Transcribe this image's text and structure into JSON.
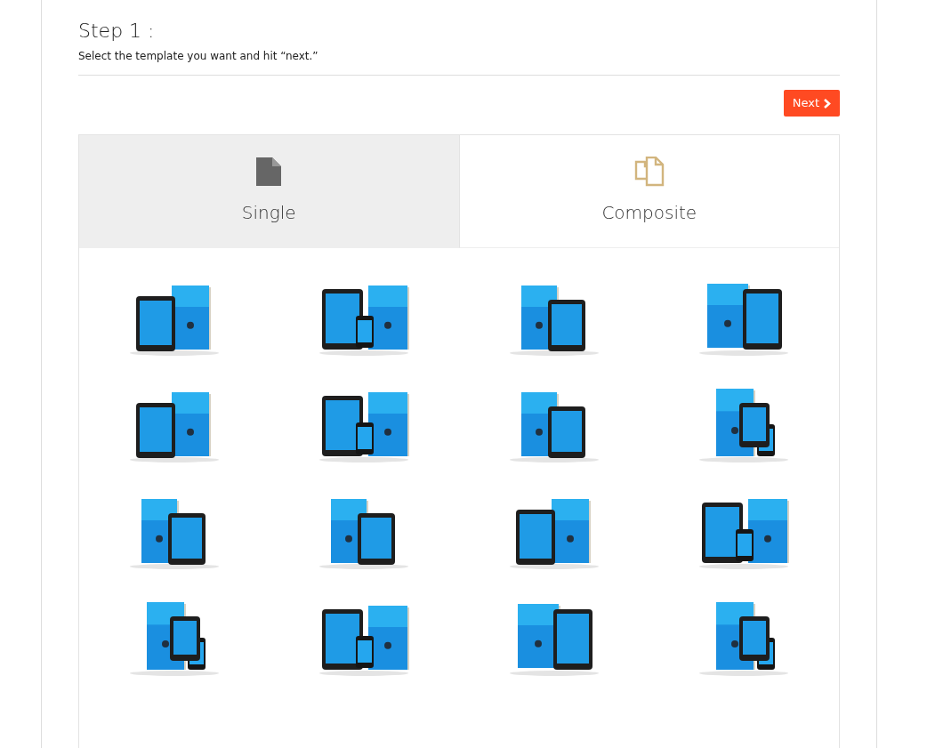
{
  "step": {
    "title": "Step 1 :",
    "instruction": "Select the template you want and hit “next.”"
  },
  "next_button": {
    "label": "Next"
  },
  "tabs": [
    {
      "label": "Single",
      "kind": "single",
      "selected": false
    },
    {
      "label": "Composite",
      "kind": "composite",
      "selected": true
    }
  ]
}
